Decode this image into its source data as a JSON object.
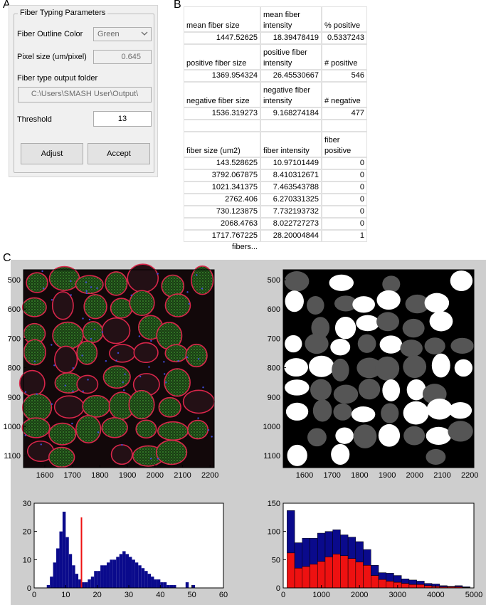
{
  "panel_labels": {
    "a": "A",
    "b": "B",
    "c": "C"
  },
  "fiber_typing": {
    "title": "Fiber Typing Parameters",
    "outline_color_label": "Fiber Outline Color",
    "outline_color_value": "Green",
    "pixel_size_label": "Pixel size (um/pixel)",
    "pixel_size_value": "0.645",
    "output_folder_label": "Fiber type output folder",
    "output_folder_value": "C:\\Users\\SMASH User\\Output\\",
    "threshold_label": "Threshold",
    "threshold_value": "13",
    "adjust_label": "Adjust",
    "accept_label": "Accept"
  },
  "spreadsheet": {
    "summary": [
      {
        "h1": "mean fiber size",
        "h2": "mean fiber intensity",
        "h3": "% positive",
        "v1": "1447.52625",
        "v2": "18.39478419",
        "v3": "0.5337243"
      },
      {
        "h1": "positive fiber size",
        "h2": "positive fiber intensity",
        "h3": "# positive",
        "v1": "1369.954324",
        "v2": "26.45530667",
        "v3": "546"
      },
      {
        "h1": "negative fiber size",
        "h2": "negative fiber intensity",
        "h3": "# negative",
        "v1": "1536.319273",
        "v2": "9.168274184",
        "v3": "477"
      }
    ],
    "table_headers": [
      "fiber size (um2)",
      "fiber intensity",
      "fiber positive"
    ],
    "rows": [
      [
        "143.528625",
        "10.97101449",
        "0"
      ],
      [
        "3792.067875",
        "8.410312671",
        "0"
      ],
      [
        "1021.341375",
        "7.463543788",
        "0"
      ],
      [
        "2762.406",
        "6.270331325",
        "0"
      ],
      [
        "730.123875",
        "7.732193732",
        "0"
      ],
      [
        "2068.4763",
        "8.022727273",
        "0"
      ],
      [
        "1717.767225",
        "28.20004844",
        "1"
      ]
    ],
    "footer": "fibers..."
  },
  "images": {
    "y_ticks": [
      "500",
      "600",
      "700",
      "800",
      "900",
      "1000",
      "1100"
    ],
    "x_ticks": [
      "1600",
      "1700",
      "1800",
      "1900",
      "2000",
      "2100",
      "2200"
    ]
  },
  "colors": {
    "hist_blue": "#0a0a8c",
    "hist_red": "#ee1111",
    "fluor_red": "#d8264a",
    "fluor_green": "#2f7d28"
  },
  "chart_data": [
    {
      "type": "bar",
      "x_ticks": [
        "0",
        "10",
        "20",
        "30",
        "40",
        "50",
        "60"
      ],
      "y_ticks": [
        "0",
        "10",
        "20",
        "30"
      ],
      "xlim": [
        0,
        60
      ],
      "ylim": [
        0,
        30
      ],
      "threshold_line": 15,
      "bins_x": [
        4,
        5,
        6,
        7,
        8,
        9,
        10,
        11,
        12,
        13,
        14,
        15,
        16,
        17,
        18,
        19,
        20,
        21,
        22,
        23,
        24,
        25,
        26,
        27,
        28,
        29,
        30,
        31,
        32,
        33,
        34,
        35,
        36,
        37,
        38,
        39,
        40,
        41,
        42,
        43,
        44,
        48,
        50
      ],
      "bins_y": [
        1,
        4,
        9,
        14,
        20,
        27,
        18,
        12,
        8,
        5,
        3,
        2,
        2,
        3,
        4,
        6,
        6,
        8,
        8,
        9,
        10,
        10,
        11,
        12,
        13,
        12,
        11,
        10,
        9,
        8,
        7,
        6,
        5,
        4,
        3,
        3,
        2,
        2,
        1,
        1,
        1,
        2,
        1
      ]
    },
    {
      "type": "bar",
      "stacked": true,
      "x_ticks": [
        "0",
        "1000",
        "2000",
        "3000",
        "4000",
        "5000"
      ],
      "y_ticks": [
        "0",
        "50",
        "100",
        "150"
      ],
      "xlim": [
        0,
        5000
      ],
      "ylim": [
        0,
        150
      ],
      "categories": [
        200,
        400,
        600,
        800,
        1000,
        1200,
        1400,
        1600,
        1800,
        2000,
        2200,
        2400,
        2600,
        2800,
        3000,
        3200,
        3400,
        3600,
        3800,
        4000,
        4200,
        4400,
        4600,
        4800
      ],
      "series": [
        {
          "values": [
            62,
            35,
            38,
            42,
            47,
            55,
            60,
            57,
            52,
            46,
            40,
            22,
            15,
            12,
            10,
            8,
            6,
            6,
            4,
            3,
            2,
            2,
            2,
            1
          ]
        },
        {
          "values": [
            75,
            45,
            50,
            46,
            50,
            45,
            43,
            37,
            38,
            36,
            28,
            18,
            12,
            14,
            12,
            8,
            8,
            6,
            4,
            4,
            2,
            1,
            2,
            1
          ]
        }
      ]
    }
  ]
}
